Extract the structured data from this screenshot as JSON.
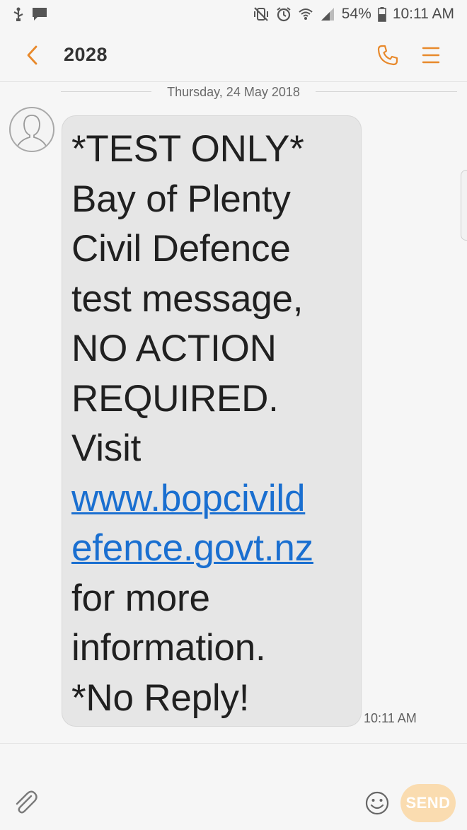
{
  "status_bar": {
    "battery_percent": "54%",
    "time": "10:11 AM",
    "left_icons": [
      "usb-debug-icon",
      "message-notification-icon"
    ],
    "right_icons": [
      "vibrate-mute-icon",
      "alarm-icon",
      "wifi-icon",
      "signal-icon",
      "battery-icon"
    ]
  },
  "header": {
    "title": "2028",
    "icons": [
      "back-chevron-icon",
      "phone-icon",
      "menu-icon"
    ]
  },
  "conversation": {
    "date": "Thursday, 24 May 2018",
    "message": {
      "text_before_link": "*TEST ONLY*\nBay of Plenty\nCivil Defence\ntest message,\nNO ACTION\nREQUIRED.\nVisit\n",
      "link": "www.bopcivild\nefence.govt.nz",
      "text_after_link": "\nfor more\ninformation.\n*No Reply!",
      "time": "10:11 AM"
    }
  },
  "compose": {
    "placeholder": "",
    "send_label": "SEND",
    "icons": [
      "paperclip-icon",
      "emoji-icon"
    ]
  },
  "colors": {
    "accent": "#e8892b",
    "link": "#1a6fd0",
    "bubble": "#e6e6e6",
    "send_disabled": "#fadcb0",
    "background": "#f6f6f6"
  }
}
